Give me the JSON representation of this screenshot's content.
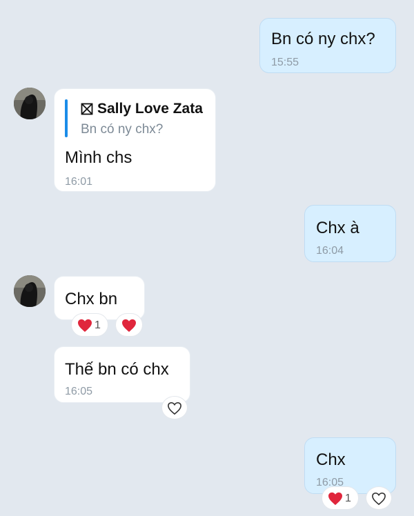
{
  "messages": {
    "m1": {
      "text": "Bn có ny chx?",
      "time": "15:55"
    },
    "m2": {
      "quote_name": "Sally Love Zata",
      "quote_text": "Bn có ny chx?",
      "text": "Mình chs",
      "time": "16:01"
    },
    "m3": {
      "text": "Chx à",
      "time": "16:04"
    },
    "m4": {
      "text": "Chx bn",
      "reaction_count": "1"
    },
    "m5": {
      "text": "Thế bn có chx",
      "time": "16:05"
    },
    "m6": {
      "text": "Chx",
      "time": "16:05",
      "reaction_count": "1"
    }
  },
  "colors": {
    "background": "#e2e8ef",
    "outgoing_bubble": "#d7efff",
    "incoming_bubble": "#ffffff",
    "quote_bar": "#1a8ce8",
    "heart": "#e0263c"
  },
  "icons": {
    "quote_prefix": "crossed-box-icon",
    "reaction": "heart-icon",
    "add_reaction": "heart-outline-icon"
  }
}
